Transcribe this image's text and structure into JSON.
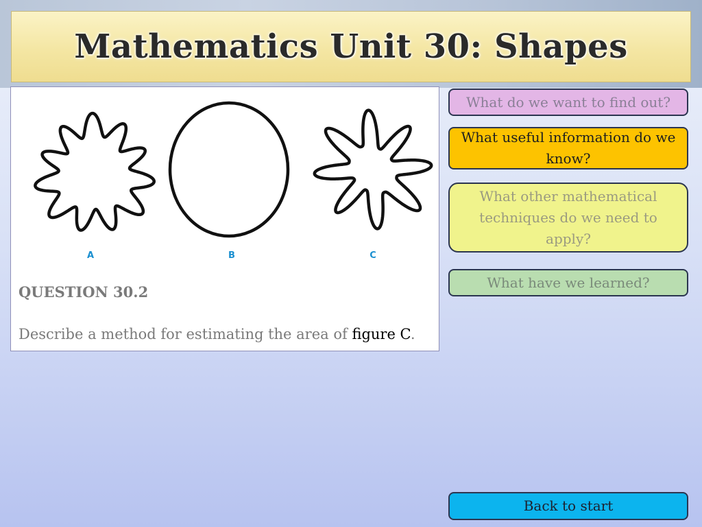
{
  "title": "Mathematics Unit 30: Shapes",
  "question": {
    "number": "QUESTION 30.2",
    "text_before": "Describe a method for estimating the area of ",
    "text_highlight": "figure C",
    "text_after": ".",
    "figure_labels": [
      "A",
      "B",
      "C"
    ]
  },
  "nav": {
    "find_out": "What do we want to find out?",
    "useful_info": "What useful information do we know?",
    "techniques": "What other mathematical techniques do we need to apply?",
    "learned": "What have we learned?",
    "back": "Back to start"
  },
  "colors": {
    "find_out": "#e3b6e6",
    "useful_info": "#fdc300",
    "techniques": "#f0f38c",
    "learned": "#b9ddb0",
    "back": "#0cb4ee",
    "label": "#1a8fd0"
  }
}
